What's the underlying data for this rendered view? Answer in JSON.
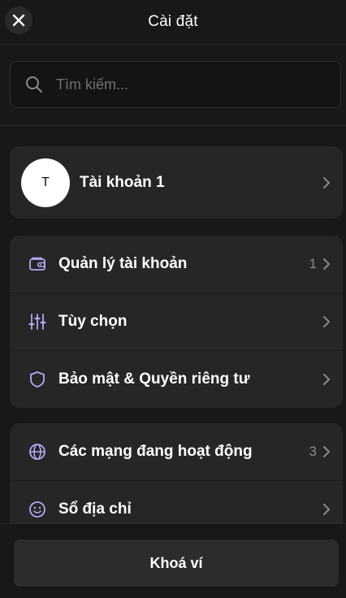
{
  "header": {
    "title": "Cài đặt",
    "close_icon": "close-icon"
  },
  "search": {
    "placeholder": "Tìm kiếm...",
    "value": "",
    "icon": "search-icon"
  },
  "account": {
    "avatar_initial": "T",
    "name": "Tài khoản 1"
  },
  "settings_group_1": [
    {
      "icon": "wallet-icon",
      "label": "Quản lý tài khoản",
      "count": "1"
    },
    {
      "icon": "sliders-icon",
      "label": "Tùy chọn",
      "count": ""
    },
    {
      "icon": "shield-icon",
      "label": "Bảo mật & Quyền riêng tư",
      "count": ""
    }
  ],
  "settings_group_2": [
    {
      "icon": "globe-icon",
      "label": "Các mạng đang hoạt động",
      "count": "3"
    },
    {
      "icon": "smiley-icon",
      "label": "Sổ địa chỉ",
      "count": ""
    }
  ],
  "footer": {
    "lock_label": "Khoá ví"
  },
  "colors": {
    "background": "#181818",
    "card": "#262626",
    "icon_accent": "#b9a6f5",
    "muted_text": "#8a8a8a"
  }
}
